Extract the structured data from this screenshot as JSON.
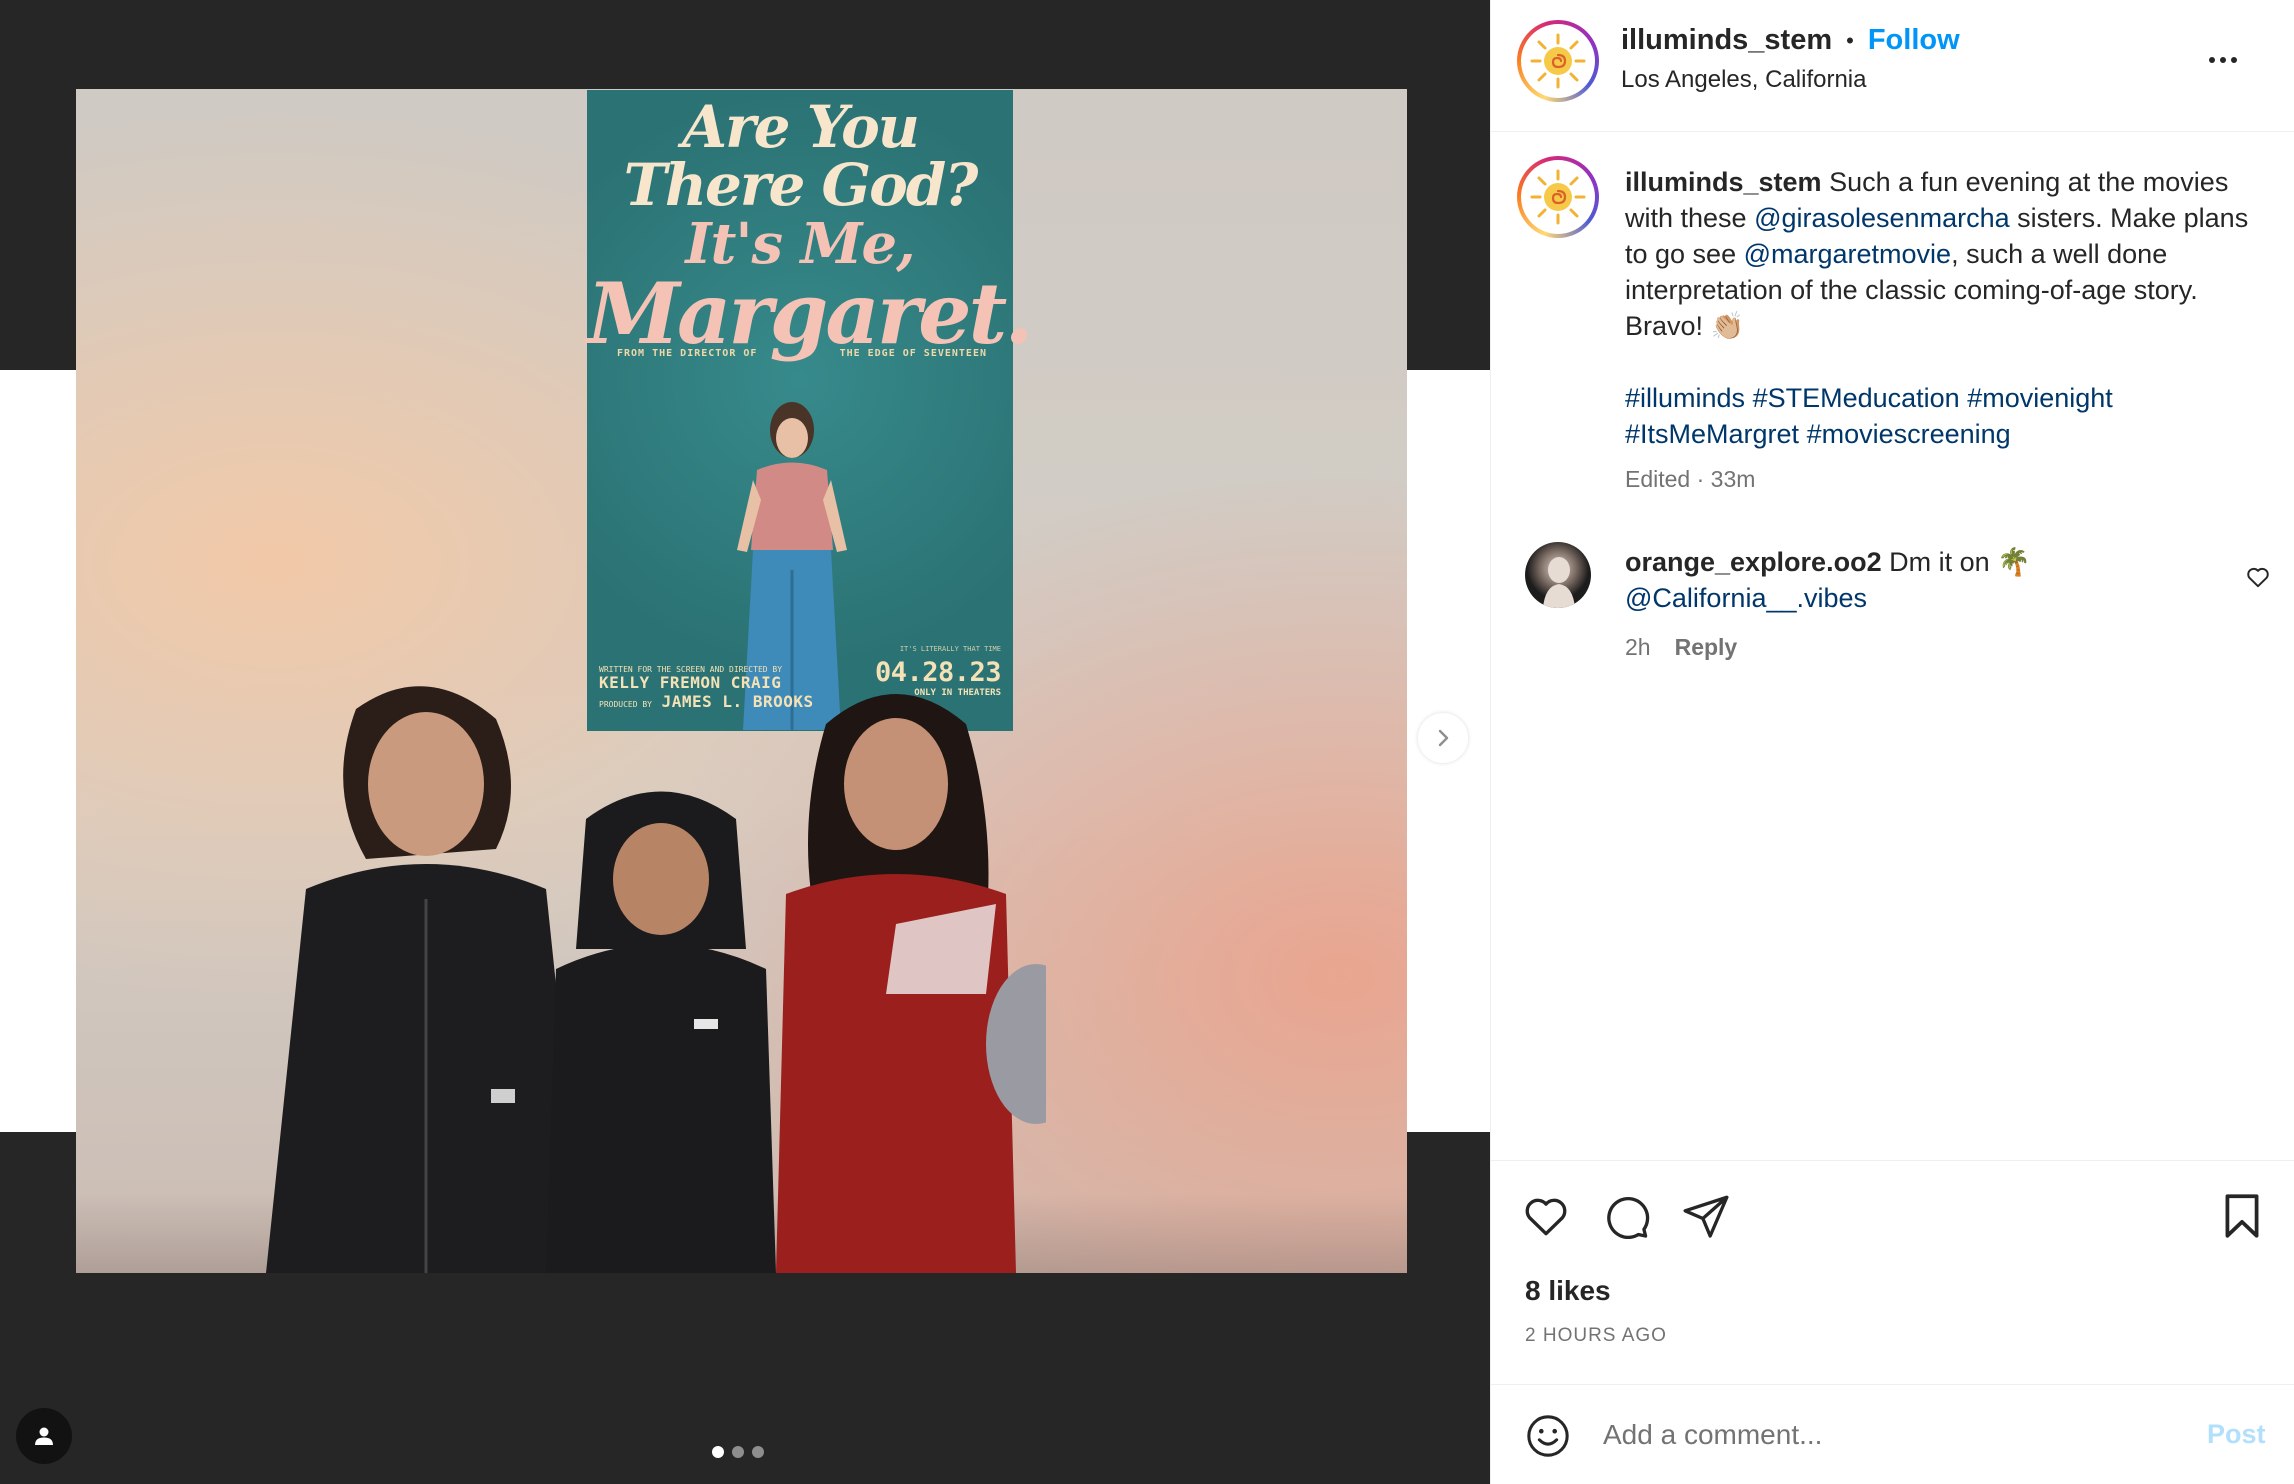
{
  "post": {
    "username": "illuminds_stem",
    "separator": "•",
    "follow_label": "Follow",
    "location": "Los Angeles, California",
    "more_label": "More options"
  },
  "media": {
    "poster": {
      "line1": "Are You There God?",
      "line2": "It's Me,",
      "line3": "Margaret.",
      "credit_left": "FROM THE DIRECTOR OF",
      "credit_right": "THE EDGE OF SEVENTEEN",
      "written_small": "WRITTEN FOR THE SCREEN AND DIRECTED BY",
      "director": "KELLY FREMON CRAIG",
      "produced_small": "PRODUCED BY",
      "producer": "JAMES L. BROOKS",
      "tagline_small": "IT'S LITERALLY THAT TIME",
      "date": "04.28.23",
      "only_in": "ONLY IN THEATERS"
    },
    "carousel": {
      "total": 3,
      "current": 1
    }
  },
  "caption": {
    "username": "illuminds_stem",
    "text_1": " Such a fun evening at the movies with these ",
    "mention_1": "@girasolesenmarcha",
    "text_2": " sisters. Make plans to go see ",
    "mention_2": "@margaretmovie",
    "text_3": ", such a well done interpretation of the classic coming-of-age story. Bravo! 👏🏼",
    "hashtags": [
      "#illuminds",
      "#STEMeducation",
      "#movienight",
      "#ItsMeMargret",
      "#moviescreening"
    ],
    "edited": "Edited",
    "meta_sep": "·",
    "time": "33m"
  },
  "comment": {
    "username": "orange_explore.oo2",
    "text": " Dm it on 🌴",
    "mention": "@California__.vibes",
    "time": "2h",
    "reply_label": "Reply"
  },
  "stats": {
    "likes": "8 likes",
    "time_ago": "2 HOURS AGO"
  },
  "composer": {
    "placeholder": "Add a comment...",
    "post_label": "Post"
  },
  "colors": {
    "accent": "#0095f6",
    "link": "#00376b",
    "muted": "#737373",
    "post_disabled": "#b2dffc",
    "poster_bg": "#2d7a7c"
  },
  "icons": [
    "heart-icon",
    "comment-icon",
    "share-icon",
    "bookmark-icon",
    "emoji-icon",
    "chevron-right-icon",
    "user-tag-icon",
    "more-icon"
  ]
}
